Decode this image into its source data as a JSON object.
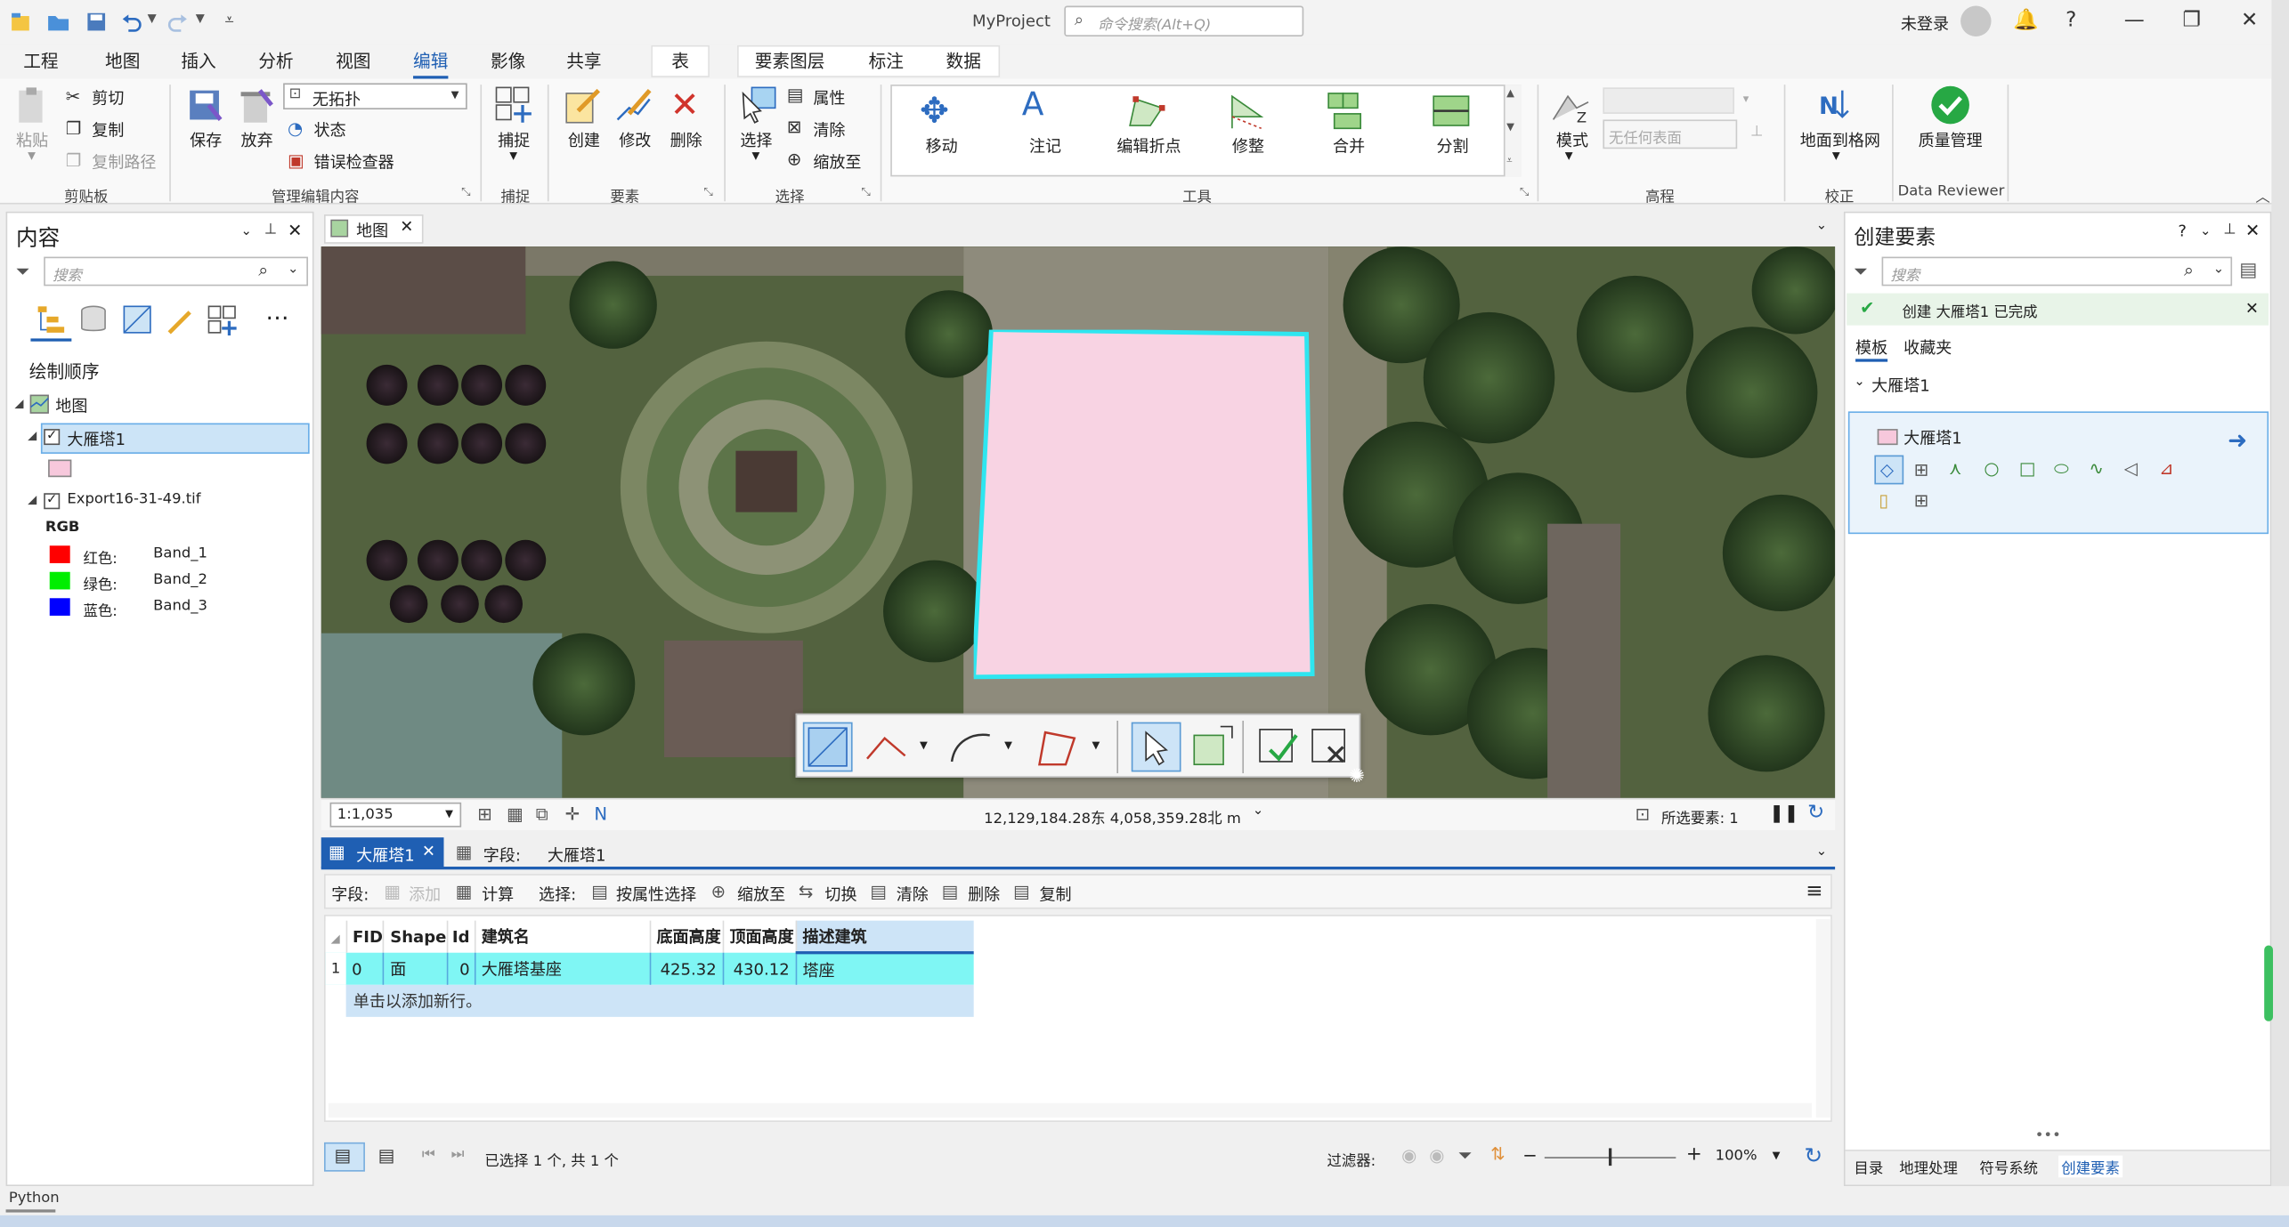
{
  "app": {
    "title": "MyProject",
    "command_search_placeholder": "命令搜索(Alt+Q)",
    "login": "未登录"
  },
  "ribbon_tabs": [
    "工程",
    "地图",
    "插入",
    "分析",
    "视图",
    "编辑",
    "影像",
    "共享",
    "表",
    "要素图层",
    "标注",
    "数据"
  ],
  "active_tab": "编辑",
  "ribbon": {
    "clipboard": {
      "paste": "粘贴",
      "cut": "剪切",
      "copy": "复制",
      "copy_path": "复制路径",
      "group": "剪贴板"
    },
    "manage_edits": {
      "save": "保存",
      "discard": "放弃",
      "topology_select": "无拓扑",
      "status": "状态",
      "error_inspector": "错误检查器",
      "group": "管理编辑内容"
    },
    "snapping": {
      "snap": "捕捉",
      "group": "捕捉"
    },
    "features": {
      "create": "创建",
      "modify": "修改",
      "delete": "删除",
      "group": "要素"
    },
    "selection": {
      "select": "选择",
      "attributes": "属性",
      "clear": "清除",
      "zoom_to": "缩放至",
      "group": "选择"
    },
    "tools": {
      "items": [
        "移动",
        "注记",
        "编辑折点",
        "修整",
        "合并",
        "分割"
      ],
      "group": "工具"
    },
    "elevation": {
      "mode": "模式",
      "surface_placeholder": "无任何表面",
      "group": "高程"
    },
    "correction": {
      "ground_to_grid": "地面到格网",
      "group": "校正"
    },
    "data_reviewer": {
      "quality": "质量管理",
      "group": "Data Reviewer"
    }
  },
  "contents": {
    "title": "内容",
    "search_placeholder": "搜索",
    "drawing_order": "绘制顺序",
    "map": "地图",
    "layer1": "大雁塔1",
    "layer1_color": "#f7c8dc",
    "raster": "Export16-31-49.tif",
    "rgb": "RGB",
    "bands": [
      {
        "label": "红色:",
        "band": "Band_1",
        "color": "#ff0000"
      },
      {
        "label": "绿色:",
        "band": "Band_2",
        "color": "#00ee00"
      },
      {
        "label": "蓝色:",
        "band": "Band_3",
        "color": "#0000ff"
      }
    ]
  },
  "map": {
    "tab": "地图",
    "scale": "1:1,035",
    "coords": "12,129,184.28东 4,058,359.28北 m",
    "selected": "所选要素: 1",
    "polygon_fill": "#f8d3e3",
    "polygon_outline": "#2ee6f0"
  },
  "table": {
    "tab": "大雁塔1",
    "fields_tab": "字段:",
    "fields_tab_value": "大雁塔1",
    "toolbar": {
      "fields": "字段:",
      "add": "添加",
      "calc": "计算",
      "select_label": "选择:",
      "by_attr": "按属性选择",
      "zoom": "缩放至",
      "switch": "切换",
      "clear": "清除",
      "delete": "删除",
      "copy": "复制"
    },
    "columns": [
      "FID",
      "Shape",
      "Id",
      "建筑名",
      "底面高度",
      "顶面高度",
      "描述建筑"
    ],
    "rows": [
      [
        "0",
        "面",
        "0",
        "大雁塔基座",
        "425.32",
        "430.12",
        "塔座"
      ]
    ],
    "row_number": "1",
    "add_row": "单击以添加新行。",
    "status": "已选择 1 个, 共 1 个",
    "filter": "过滤器:",
    "zoom": "100%"
  },
  "create_features": {
    "title": "创建要素",
    "search_placeholder": "搜索",
    "notice": "创建 大雁塔1 已完成",
    "tabs": [
      "模板",
      "收藏夹"
    ],
    "group": "大雁塔1",
    "template": "大雁塔1",
    "bottom_tabs": [
      "目录",
      "地理处理",
      "符号系统",
      "创建要素"
    ]
  },
  "python": "Python"
}
